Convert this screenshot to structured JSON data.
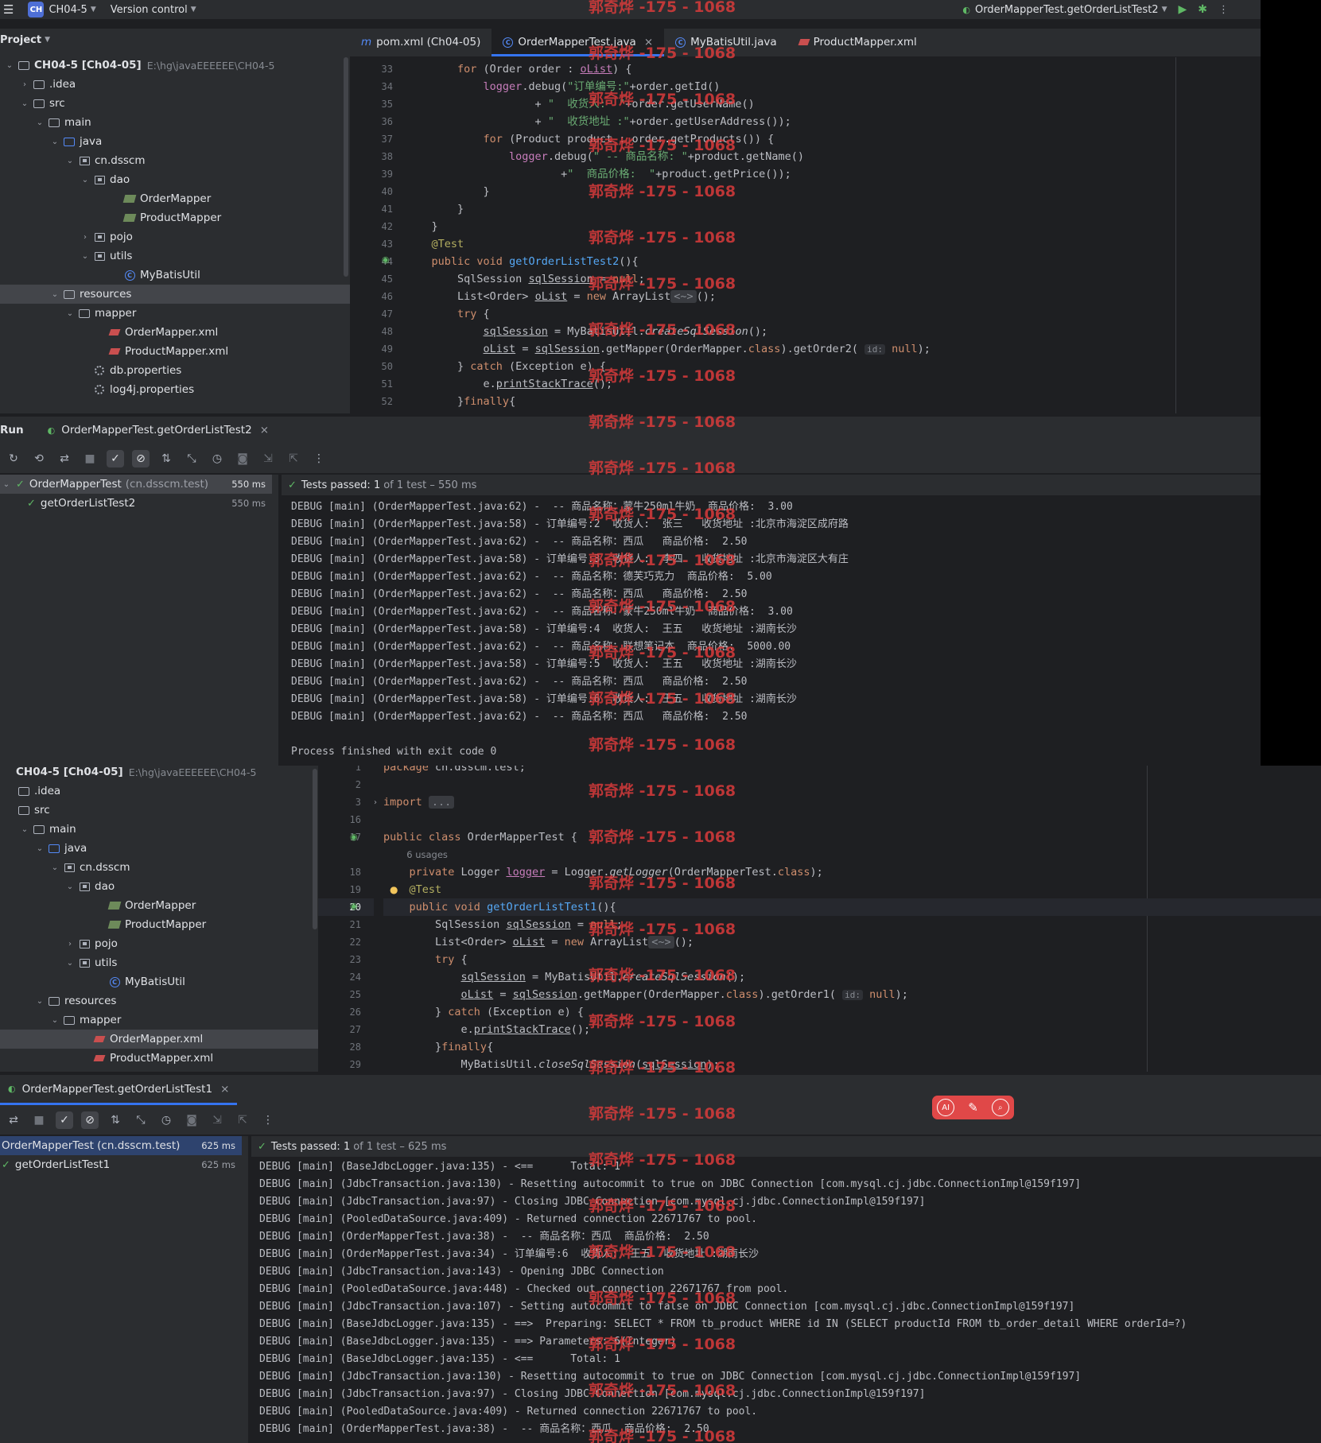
{
  "topbar": {
    "menu_icon": "hamburger-icon",
    "project_badge": "CH",
    "project_name": "CH04-5",
    "vcs": "Version control",
    "run_config": "OrderMapperTest.getOrderListTest2"
  },
  "top": {
    "project_label": "Project",
    "tree": [
      {
        "label": "CH04-5 [Ch04-05]",
        "hint": "E:\\hg\\javaEEEEEE\\CH04-5",
        "depth": 0,
        "arrow": "down",
        "icon": "module"
      },
      {
        "label": ".idea",
        "depth": 1,
        "arrow": "right",
        "icon": "folder"
      },
      {
        "label": "src",
        "depth": 1,
        "arrow": "down",
        "icon": "folder"
      },
      {
        "label": "main",
        "depth": 2,
        "arrow": "down",
        "icon": "folder"
      },
      {
        "label": "java",
        "depth": 3,
        "arrow": "down",
        "icon": "folder-blue"
      },
      {
        "label": "cn.dsscm",
        "depth": 4,
        "arrow": "down",
        "icon": "pkg"
      },
      {
        "label": "dao",
        "depth": 5,
        "arrow": "down",
        "icon": "pkg"
      },
      {
        "label": "OrderMapper",
        "depth": 7,
        "arrow": "",
        "icon": "iface"
      },
      {
        "label": "ProductMapper",
        "depth": 7,
        "arrow": "",
        "icon": "iface"
      },
      {
        "label": "pojo",
        "depth": 5,
        "arrow": "right",
        "icon": "pkg"
      },
      {
        "label": "utils",
        "depth": 5,
        "arrow": "down",
        "icon": "pkg"
      },
      {
        "label": "MyBatisUtil",
        "depth": 7,
        "arrow": "",
        "icon": "cls"
      },
      {
        "label": "resources",
        "depth": 3,
        "arrow": "down",
        "icon": "folder",
        "selected": true
      },
      {
        "label": "mapper",
        "depth": 4,
        "arrow": "down",
        "icon": "folder"
      },
      {
        "label": "OrderMapper.xml",
        "depth": 6,
        "arrow": "",
        "icon": "xml"
      },
      {
        "label": "ProductMapper.xml",
        "depth": 6,
        "arrow": "",
        "icon": "xml"
      },
      {
        "label": "db.properties",
        "depth": 5,
        "arrow": "",
        "icon": "gear"
      },
      {
        "label": "log4j.properties",
        "depth": 5,
        "arrow": "",
        "icon": "gear"
      }
    ],
    "tabs": [
      {
        "label": "pom.xml (Ch04-05)",
        "icon": "maven-icon"
      },
      {
        "label": "OrderMapperTest.java",
        "icon": "class-icon",
        "active": true,
        "close": "×"
      },
      {
        "label": "MyBatisUtil.java",
        "icon": "class-icon"
      },
      {
        "label": "ProductMapper.xml",
        "icon": "xml-icon"
      }
    ],
    "line_numbers": [
      "33",
      "34",
      "35",
      "36",
      "37",
      "38",
      "39",
      "40",
      "41",
      "42",
      "43",
      "44",
      "45",
      "46",
      "47",
      "48",
      "49",
      "50",
      "51",
      "52"
    ],
    "run_label": "Run",
    "run_tab": "OrderMapperTest.getOrderListTest2",
    "test_root": "OrderMapperTest",
    "test_root_pkg": "(cn.dsscm.test)",
    "test_root_ms": "550 ms",
    "test_child": "getOrderListTest2",
    "test_child_ms": "550 ms",
    "passed_bold": "Tests passed: 1",
    "passed_rest": "of 1 test – 550 ms",
    "log": [
      "DEBUG [main] (OrderMapperTest.java:62) -  -- 商品名称：蒙牛250ml牛奶  商品价格:  3.00",
      "DEBUG [main] (OrderMapperTest.java:58) - 订单编号:2  收货人:  张三   收货地址 :北京市海淀区成府路",
      "DEBUG [main] (OrderMapperTest.java:62) -  -- 商品名称：西瓜   商品价格:  2.50",
      "DEBUG [main] (OrderMapperTest.java:58) - 订单编号:3  收货人:  李四   收货地址 :北京市海淀区大有庄",
      "DEBUG [main] (OrderMapperTest.java:62) -  -- 商品名称：德芙巧克力  商品价格:  5.00",
      "DEBUG [main] (OrderMapperTest.java:62) -  -- 商品名称：西瓜   商品价格:  2.50",
      "DEBUG [main] (OrderMapperTest.java:62) -  -- 商品名称：蒙牛250ml牛奶  商品价格:  3.00",
      "DEBUG [main] (OrderMapperTest.java:58) - 订单编号:4  收货人:  王五   收货地址 :湖南长沙",
      "DEBUG [main] (OrderMapperTest.java:62) -  -- 商品名称：联想笔记本  商品价格:  5000.00",
      "DEBUG [main] (OrderMapperTest.java:58) - 订单编号:5  收货人:  王五   收货地址 :湖南长沙",
      "DEBUG [main] (OrderMapperTest.java:62) -  -- 商品名称：西瓜   商品价格:  2.50",
      "DEBUG [main] (OrderMapperTest.java:58) - 订单编号:6  收货人:  王五   收货地址 :湖南长沙",
      "DEBUG [main] (OrderMapperTest.java:62) -  -- 商品名称：西瓜   商品价格:  2.50",
      "",
      "Process finished with exit code 0"
    ]
  },
  "bottom": {
    "tree": [
      {
        "label": "CH04-5 [Ch04-05]",
        "hint": "E:\\hg\\javaEEEEEE\\CH04-5",
        "depth": 0,
        "arrow": "",
        "icon": ""
      },
      {
        "label": ".idea",
        "depth": 0,
        "arrow": "",
        "icon": "folder"
      },
      {
        "label": "src",
        "depth": 0,
        "arrow": "",
        "icon": "folder"
      },
      {
        "label": "main",
        "depth": 1,
        "arrow": "down",
        "icon": "folder"
      },
      {
        "label": "java",
        "depth": 2,
        "arrow": "down",
        "icon": "folder-blue"
      },
      {
        "label": "cn.dsscm",
        "depth": 3,
        "arrow": "down",
        "icon": "pkg"
      },
      {
        "label": "dao",
        "depth": 4,
        "arrow": "down",
        "icon": "pkg"
      },
      {
        "label": "OrderMapper",
        "depth": 6,
        "arrow": "",
        "icon": "iface"
      },
      {
        "label": "ProductMapper",
        "depth": 6,
        "arrow": "",
        "icon": "iface"
      },
      {
        "label": "pojo",
        "depth": 4,
        "arrow": "right",
        "icon": "pkg"
      },
      {
        "label": "utils",
        "depth": 4,
        "arrow": "down",
        "icon": "pkg"
      },
      {
        "label": "MyBatisUtil",
        "depth": 6,
        "arrow": "",
        "icon": "cls"
      },
      {
        "label": "resources",
        "depth": 2,
        "arrow": "down",
        "icon": "folder"
      },
      {
        "label": "mapper",
        "depth": 3,
        "arrow": "down",
        "icon": "folder"
      },
      {
        "label": "OrderMapper.xml",
        "depth": 5,
        "arrow": "",
        "icon": "xml",
        "selected": true
      },
      {
        "label": "ProductMapper.xml",
        "depth": 5,
        "arrow": "",
        "icon": "xml"
      }
    ],
    "line_numbers": [
      "1",
      "2",
      "3",
      "16",
      "17",
      "",
      "18",
      "19",
      "20",
      "21",
      "22",
      "23",
      "24",
      "25",
      "26",
      "27",
      "28",
      "29"
    ],
    "usages": "6 usages",
    "run_tab": "OrderMapperTest.getOrderListTest1",
    "test_root": "OrderMapperTest (cn.dsscm.test)",
    "test_root_ms": "625 ms",
    "test_child": "getOrderListTest1",
    "test_child_ms": "625 ms",
    "passed_bold": "Tests passed: 1",
    "passed_rest": "of 1 test – 625 ms",
    "log": [
      "DEBUG [main] (BaseJdbcLogger.java:135) - <==      Total: 1",
      "DEBUG [main] (JdbcTransaction.java:130) - Resetting autocommit to true on JDBC Connection [com.mysql.cj.jdbc.ConnectionImpl@159f197]",
      "DEBUG [main] (JdbcTransaction.java:97) - Closing JDBC Connection [com.mysql.cj.jdbc.ConnectionImpl@159f197]",
      "DEBUG [main] (PooledDataSource.java:409) - Returned connection 22671767 to pool.",
      "DEBUG [main] (OrderMapperTest.java:38) -  -- 商品名称：西瓜  商品价格:  2.50",
      "DEBUG [main] (OrderMapperTest.java:34) - 订单编号:6  收货人:  王五  收货地址 :湖南长沙",
      "DEBUG [main] (JdbcTransaction.java:143) - Opening JDBC Connection",
      "DEBUG [main] (PooledDataSource.java:448) - Checked out connection 22671767 from pool.",
      "DEBUG [main] (JdbcTransaction.java:107) - Setting autocommit to false on JDBC Connection [com.mysql.cj.jdbc.ConnectionImpl@159f197]",
      "DEBUG [main] (BaseJdbcLogger.java:135) - ==>  Preparing: SELECT * FROM tb_product WHERE id IN (SELECT productId FROM tb_order_detail WHERE orderId=?)",
      "DEBUG [main] (BaseJdbcLogger.java:135) - ==> Parameters: 6(Integer)",
      "DEBUG [main] (BaseJdbcLogger.java:135) - <==      Total: 1",
      "DEBUG [main] (JdbcTransaction.java:130) - Resetting autocommit to true on JDBC Connection [com.mysql.cj.jdbc.ConnectionImpl@159f197]",
      "DEBUG [main] (JdbcTransaction.java:97) - Closing JDBC Connection [com.mysql.cj.jdbc.ConnectionImpl@159f197]",
      "DEBUG [main] (PooledDataSource.java:409) - Returned connection 22671767 to pool.",
      "DEBUG [main] (OrderMapperTest.java:38) -  -- 商品名称：西瓜  商品价格:  2.50"
    ]
  },
  "watermark": "郭奇烨 -175 - 1068",
  "ai_toolbar": {
    "icons": [
      "ai-icon",
      "magic-wand-icon",
      "search-icon"
    ],
    "ai_label": "AI"
  },
  "colors": {
    "accent": "#3574f0",
    "pass": "#5fb865",
    "keyword": "#cf8e6d",
    "function": "#56a8f5",
    "string": "#6aab73",
    "field": "#c77dbb",
    "watermark": "#e03c3c"
  }
}
